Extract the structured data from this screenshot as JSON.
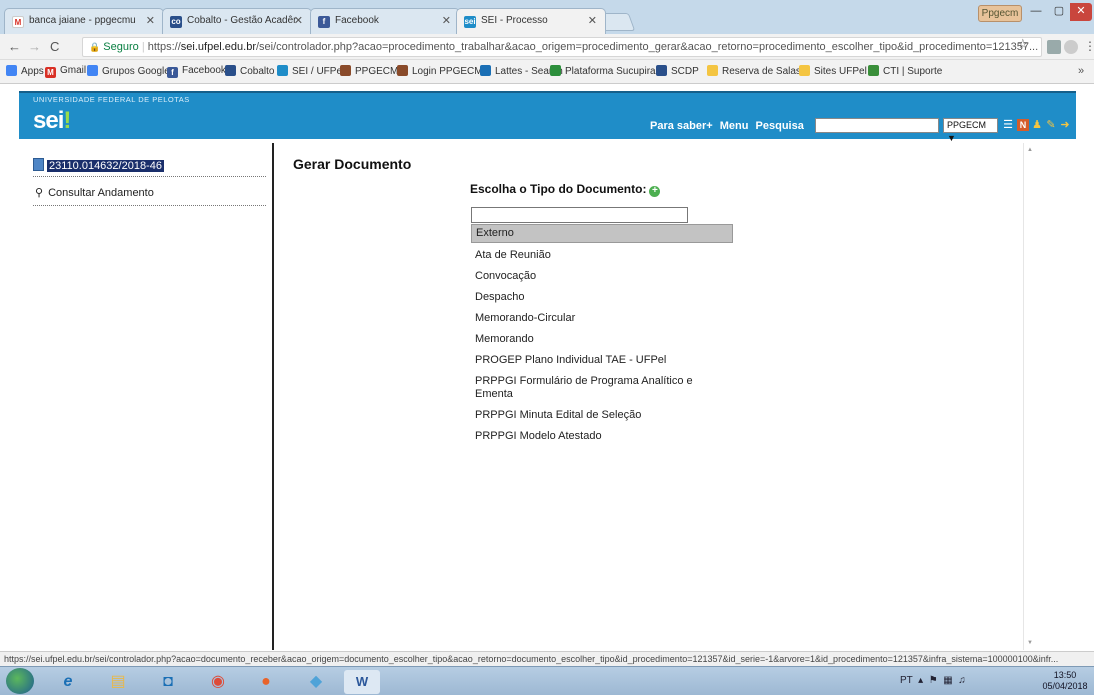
{
  "browser": {
    "tabs": [
      {
        "label": "banca jaiane - ppgecmu",
        "icon": "gmail-icon"
      },
      {
        "label": "Cobalto - Gestão Acadêr",
        "icon": "cobalto-icon"
      },
      {
        "label": "Facebook",
        "icon": "facebook-icon"
      },
      {
        "label": "SEI - Processo",
        "icon": "sei-icon"
      }
    ],
    "user_badge": "Ppgecm",
    "address": {
      "secure_label": "Seguro",
      "url_prefix": "https://",
      "url_host": "sei.ufpel.edu.br",
      "url_rest": "/sei/controlador.php?acao=procedimento_trabalhar&acao_origem=procedimento_gerar&acao_retorno=procedimento_escolher_tipo&id_procedimento=121357..."
    },
    "bookmarks": [
      {
        "label": "Apps",
        "color": "#4285f4"
      },
      {
        "label": "Gmail",
        "color": "#d93025"
      },
      {
        "label": "Grupos Google",
        "color": "#4285f4"
      },
      {
        "label": "Facebook",
        "color": "#3b5998"
      },
      {
        "label": "Cobalto",
        "color": "#2a4f8a"
      },
      {
        "label": "SEI / UFPel",
        "color": "#1f8dc8"
      },
      {
        "label": "PPGECM",
        "color": "#8a4b2a"
      },
      {
        "label": "Login PPGECM",
        "color": "#8a4b2a"
      },
      {
        "label": "Lattes - Search",
        "color": "#1a6fb5"
      },
      {
        "label": "Plataforma Sucupira",
        "color": "#2d8f3c"
      },
      {
        "label": "SCDP",
        "color": "#2a4f8a"
      },
      {
        "label": "Reserva de Salas",
        "color": "#f4c542"
      },
      {
        "label": "Sites UFPel",
        "color": "#f4c542"
      },
      {
        "label": "CTI | Suporte",
        "color": "#3a8f3a"
      }
    ],
    "more": "»"
  },
  "sei": {
    "university": "UNIVERSIDADE FEDERAL DE PELOTAS",
    "logo": "sei",
    "logo_dot": "!",
    "links": [
      "Para saber+",
      "Menu",
      "Pesquisa"
    ],
    "unit_select": "PPGECM ▼"
  },
  "left_panel": {
    "process_number": "23110.014632/2018-46",
    "consult_label": "Consultar Andamento"
  },
  "main": {
    "title": "Gerar Documento",
    "choose_label": "Escolha o Tipo do Documento:",
    "plus": "+",
    "document_types": [
      "Externo",
      "Ata de Reunião",
      "Convocação",
      "Despacho",
      "Memorando-Circular",
      "Memorando",
      "PROGEP Plano Individual TAE - UFPel",
      "PRPPGI Formulário de Programa Analítico e Ementa",
      "PRPPGI Minuta Edital de Seleção",
      "PRPPGI Modelo Atestado"
    ],
    "selected_index": 0
  },
  "status_url": "https://sei.ufpel.edu.br/sei/controlador.php?acao=documento_receber&acao_origem=documento_escolher_tipo&acao_retorno=documento_escolher_tipo&id_procedimento=121357&id_serie=-1&arvore=1&id_procedimento=121357&infra_sistema=100000100&infr...",
  "taskbar": {
    "tray_lang": "PT",
    "clock_time": "13:50",
    "clock_date": "05/04/2018"
  }
}
